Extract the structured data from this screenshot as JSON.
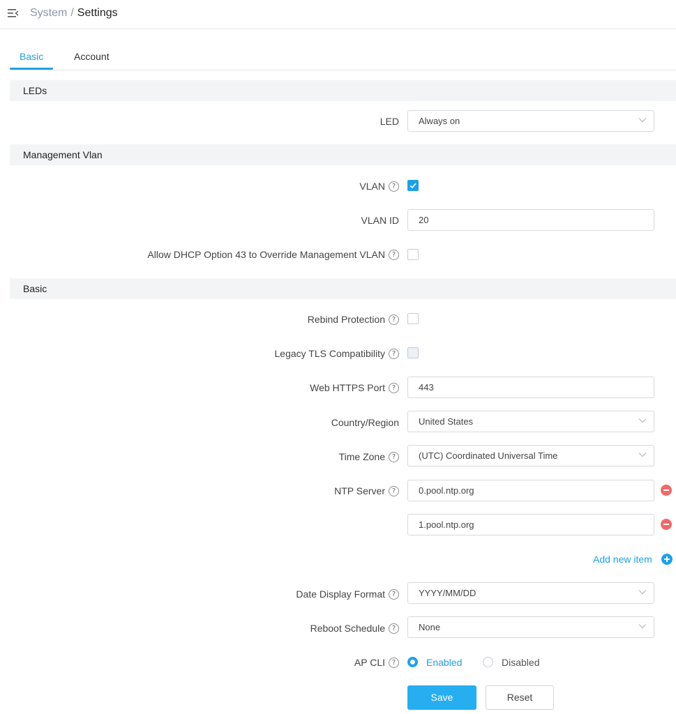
{
  "breadcrumb": {
    "parent": "System",
    "separator": "/",
    "current": "Settings"
  },
  "tabs": [
    {
      "label": "Basic",
      "active": true
    },
    {
      "label": "Account",
      "active": false
    }
  ],
  "sections": {
    "leds": {
      "title": "LEDs"
    },
    "mgmt_vlan": {
      "title": "Management Vlan"
    },
    "basic": {
      "title": "Basic"
    }
  },
  "fields": {
    "led": {
      "label": "LED",
      "value": "Always on"
    },
    "vlan": {
      "label": "VLAN",
      "checked": true
    },
    "vlan_id": {
      "label": "VLAN ID",
      "value": "20"
    },
    "dhcp43": {
      "label": "Allow DHCP Option 43 to Override Management VLAN",
      "checked": false
    },
    "rebind": {
      "label": "Rebind Protection",
      "checked": false
    },
    "legacy_tls": {
      "label": "Legacy TLS Compatibility",
      "checked": false
    },
    "https_port": {
      "label": "Web HTTPS Port",
      "value": "443"
    },
    "country": {
      "label": "Country/Region",
      "value": "United States"
    },
    "timezone": {
      "label": "Time Zone",
      "value": "(UTC) Coordinated Universal Time"
    },
    "ntp": {
      "label": "NTP Server",
      "servers": [
        "0.pool.ntp.org",
        "1.pool.ntp.org"
      ]
    },
    "add_item": "Add new item",
    "date_format": {
      "label": "Date Display Format",
      "value": "YYYY/MM/DD"
    },
    "reboot": {
      "label": "Reboot Schedule",
      "value": "None"
    },
    "ap_cli": {
      "label": "AP CLI",
      "options": [
        "Enabled",
        "Disabled"
      ],
      "selected": "Enabled"
    }
  },
  "help_glyph": "?",
  "buttons": {
    "save": "Save",
    "reset": "Reset"
  },
  "colors": {
    "accent": "#20a0e4",
    "danger": "#f06a6a",
    "section_bg": "#f3f4f6"
  },
  "icons": [
    "menu-collapse-icon",
    "help-icon",
    "chevron-down-icon",
    "remove-icon",
    "add-icon",
    "checkmark-icon"
  ]
}
